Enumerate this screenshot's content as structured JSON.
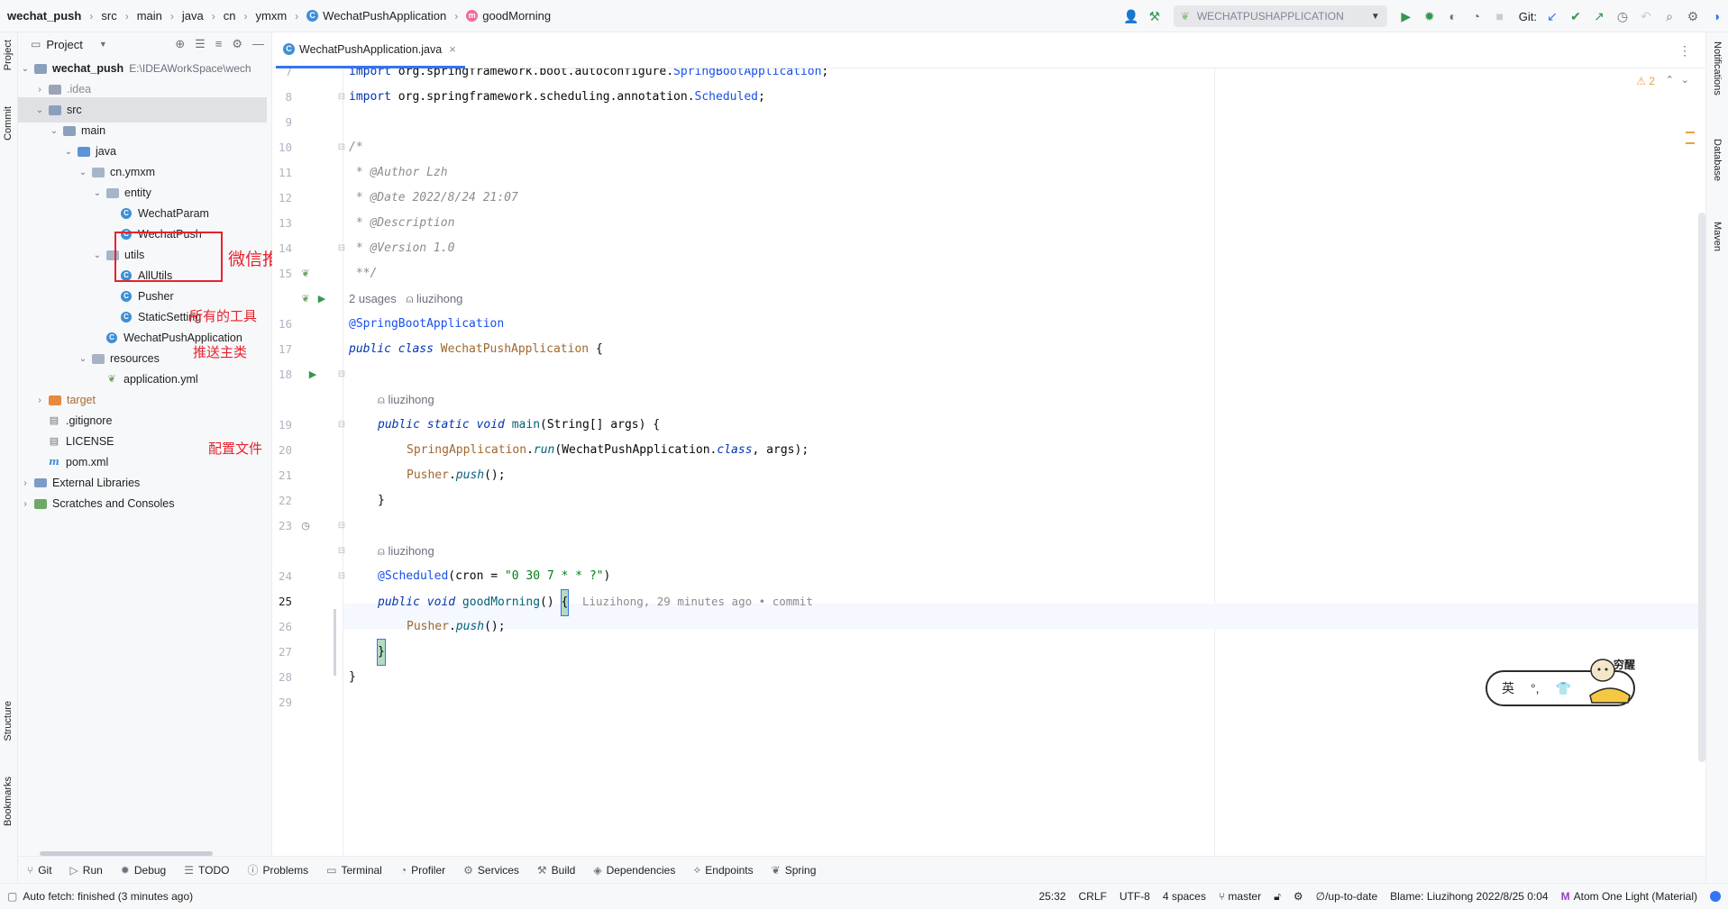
{
  "navbar": {
    "crumbs": [
      "wechat_push",
      "src",
      "main",
      "java",
      "cn",
      "ymxm",
      "WechatPushApplication",
      "goodMorning"
    ],
    "run_config": "WECHATPUSHAPPLICATION",
    "git_label": "Git:"
  },
  "left_strip": {
    "project": "Project",
    "commit": "Commit",
    "structure": "Structure",
    "bookmarks": "Bookmarks"
  },
  "right_strip": {
    "notifications": "Notifications",
    "database": "Database",
    "maven": "Maven"
  },
  "project_panel": {
    "title": "Project",
    "root_name": "wechat_push",
    "root_path": "E:\\IDEAWorkSpace\\wech",
    "items": [
      {
        "label": ".idea"
      },
      {
        "label": "src"
      },
      {
        "label": "main"
      },
      {
        "label": "java"
      },
      {
        "label": "cn.ymxm"
      },
      {
        "label": "entity"
      },
      {
        "label": "WechatParam"
      },
      {
        "label": "WechatPush"
      },
      {
        "label": "utils"
      },
      {
        "label": "AllUtils"
      },
      {
        "label": "Pusher"
      },
      {
        "label": "StaticSetting"
      },
      {
        "label": "WechatPushApplication"
      },
      {
        "label": "resources"
      },
      {
        "label": "application.yml"
      },
      {
        "label": "target"
      },
      {
        "label": ".gitignore"
      },
      {
        "label": "LICENSE"
      },
      {
        "label": "pom.xml"
      },
      {
        "label": "External Libraries"
      },
      {
        "label": "Scratches and Consoles"
      }
    ],
    "annotations": {
      "entity": "微信推送参数实体",
      "utils": "所有的工具",
      "pusher": "推送主类",
      "config": "配置文件"
    }
  },
  "editor": {
    "tab_label": "WechatPushApplication.java",
    "warning_count": "2",
    "line_numbers": [
      "7",
      "8",
      "9",
      "10",
      "11",
      "12",
      "13",
      "14",
      "15",
      "16",
      "17",
      "18",
      "19",
      "20",
      "21",
      "22",
      "23",
      "24",
      "25",
      "26",
      "27",
      "28",
      "29"
    ],
    "lines": {
      "l7_kw": "import ",
      "l7_pkg": "org.springframework.boot.autoconfigure.",
      "l7_cls": "SpringBootApplication",
      "l7_end": ";",
      "l8_kw": "import ",
      "l8_pkg": "org.springframework.scheduling.annotation.",
      "l8_cls": "Scheduled",
      "l8_end": ";",
      "l10": "/*",
      "l11": " * @Author Lzh",
      "l12": " * @Date 2022/8/24 21:07",
      "l13": " * @Description",
      "l14": " * @Version 1.0",
      "l15": " **/",
      "usages": "2 usages",
      "author": "liuzihong",
      "l16": "@SpringBootApplication",
      "l17_kw": "public class ",
      "l17_name": "WechatPushApplication",
      "l17_end": " {",
      "l19_kw": "public static void ",
      "l19_name": "main",
      "l19_args": "(String[] args) {",
      "l20_a": "SpringApplication",
      "l20_b": ".",
      "l20_c": "run",
      "l20_d": "(WechatPushApplication.",
      "l20_e": "class",
      "l20_f": ", args);",
      "l21_a": "Pusher",
      "l21_b": ".",
      "l21_c": "push",
      "l21_d": "();",
      "l22": "}",
      "l24_ann": "@Scheduled",
      "l24_args_a": "(cron = ",
      "l24_str": "\"0 30 7 * * ?\"",
      "l24_args_b": ")",
      "l25_kw": "public void ",
      "l25_name": "goodMorning",
      "l25_paren": "() ",
      "l25_brace": "{",
      "l25_blame": "Liuzihong, 29 minutes ago • commit",
      "l26_a": "Pusher",
      "l26_b": ".",
      "l26_c": "push",
      "l26_d": "();",
      "l27": "}",
      "l28": "}"
    }
  },
  "ime": {
    "mode": "英",
    "punct": "°,",
    "skin": "穷醒"
  },
  "bottom_tools": [
    "Git",
    "Run",
    "Debug",
    "TODO",
    "Problems",
    "Terminal",
    "Profiler",
    "Services",
    "Build",
    "Dependencies",
    "Endpoints",
    "Spring"
  ],
  "status": {
    "message": "Auto fetch: finished (3 minutes ago)",
    "position": "25:32",
    "line_sep": "CRLF",
    "encoding": "UTF-8",
    "indent": "4 spaces",
    "branch": "master",
    "vcs": "∅/up-to-date",
    "blame": "Blame: Liuzihong 2022/8/25 0:04",
    "theme": "Atom One Light (Material)"
  },
  "colors": {
    "accent": "#3574f0",
    "annotation_red": "#e8212d",
    "keyword": "#0033b3"
  }
}
